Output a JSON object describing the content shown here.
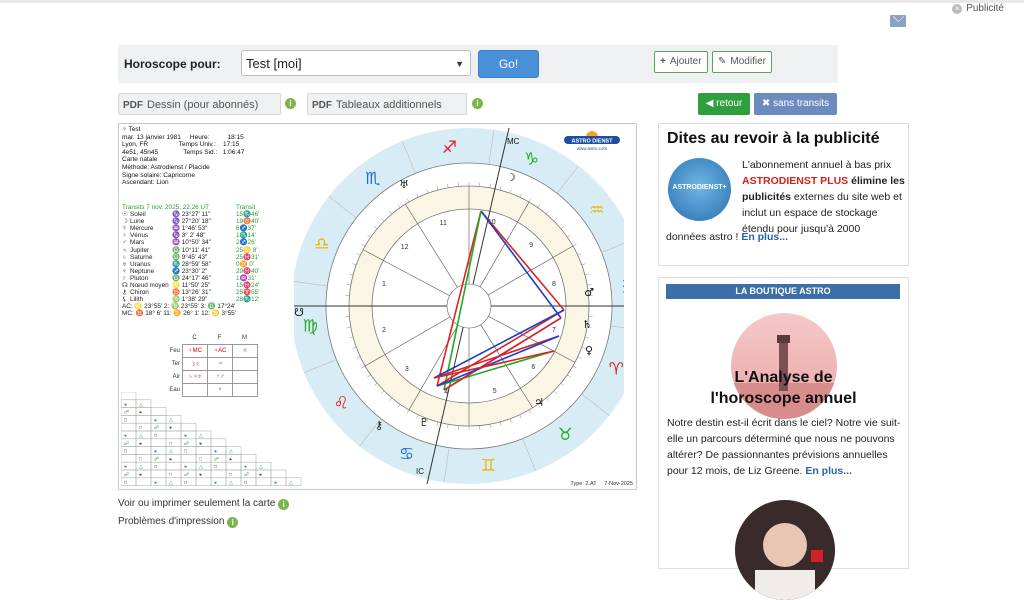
{
  "header": {
    "publicite": "Publicité"
  },
  "form": {
    "label": "Horoscope pour:",
    "selected": "Test [moi]",
    "go": "Go!",
    "ajouter": "Ajouter",
    "modifier": "Modifier"
  },
  "pdf": {
    "tag": "PDF",
    "dessin": "Dessin (pour abonnés)",
    "tableaux": "Tableaux additionnels"
  },
  "nav": {
    "retour": "retour",
    "sans_transits": "sans transits"
  },
  "chart": {
    "info_lines": [
      "♀ Test",
      "mar. 13 janvier 1981     Heure:          18:15",
      "Lyon, FR                 Temps Univ.:    17:15",
      "4e51, 45n45              Temps Sid.:   1:06:47",
      "Carte natale",
      "Méthode: Astrodienst / Placide",
      "Signe solaire: Capricorne",
      "Ascendant: Lion"
    ],
    "transit_header": "Transits 7 nov. 2025, 22:26 UT",
    "transit_label": "Transit",
    "planets": [
      {
        "g": "☉",
        "n": "Soleil",
        "p1": "♑ 23°27' 11\"",
        "p2": "15♏46'"
      },
      {
        "g": "☽",
        "n": "Lune",
        "p1": "♑ 27°20' 18\"",
        "p2": "19♉40'"
      },
      {
        "g": "☿",
        "n": "Mercure",
        "p1": "♒  1°46' 53\"",
        "p2": "6♐37'"
      },
      {
        "g": "♀",
        "n": "Vénus",
        "p1": "♑  3° 2' 48\"",
        "p2": "1♏14'"
      },
      {
        "g": "♂",
        "n": "Mars",
        "p1": "♒ 10°50' 34\"",
        "p2": "2♐26'"
      },
      {
        "g": "♃",
        "n": "Jupiter",
        "p1": "♎ 10°11' 41\"",
        "p2": "25♋ 8'"
      },
      {
        "g": "♄",
        "n": "Saturne",
        "p1": "♎  9°45' 43\"",
        "p2": "25♓31'"
      },
      {
        "g": "♅",
        "n": "Uranus",
        "p1": "♏ 28°59' 58\"",
        "p2": "0♊ 0'"
      },
      {
        "g": "♆",
        "n": "Neptune",
        "p1": "♐ 23°30'  2\"",
        "p2": "29♓40'"
      },
      {
        "g": "♇",
        "n": "Pluton",
        "p1": "♎ 24°17' 46\"",
        "p2": "1♒31'"
      },
      {
        "g": "☊",
        "n": "Nœud moyen",
        "p1": "♌ 11°50' 25\"",
        "p2": "15♓24'"
      },
      {
        "g": "⚷",
        "n": "Chiron",
        "p1": "♉ 13°26' 31\"",
        "p2": "25♈55'"
      },
      {
        "g": "⚸",
        "n": "Lilith",
        "p1": "♍  1°38' 29\"",
        "p2": "28♏12'"
      }
    ],
    "angles": [
      "AC: ♌ 23°55'   2: ♍ 23°55'   3: ♎ 17°24'",
      "MC: ♉ 18° 6'  11: ♊ 26° 1'  12: ♋  3°55'"
    ],
    "elements_head": [
      "C",
      "F",
      "M"
    ],
    "elements_rows": [
      "Feu",
      "Ter",
      "Air",
      "Eau"
    ],
    "elements_vals": [
      [
        "♀MC",
        "♃AC",
        "♅"
      ],
      [
        "☽☿",
        "♃",
        ""
      ],
      [
        "♄♃♅",
        "♇♂",
        ""
      ],
      [
        "",
        "♆",
        ""
      ]
    ],
    "house_numbers": [
      "1",
      "2",
      "3",
      "4",
      "5",
      "6",
      "7",
      "8",
      "9",
      "10",
      "11",
      "12"
    ],
    "angle_labels": [
      "AC",
      "DC",
      "MC",
      "IC"
    ],
    "logo": "ASTRO DIENST",
    "logo_url": "www.astro.com",
    "footer_left": "Type: 2.AT",
    "footer_right": "7-Nov-2025"
  },
  "links": {
    "print": "Voir ou imprimer seulement la carte",
    "problems": "Problèmes d'impression"
  },
  "ad": {
    "title": "Dites au revoir à la publicité",
    "logo_text": "ASTRODIENST+",
    "text_1": "L'abonnement annuel à bas prix ",
    "text_red": "ASTRODIENST PLUS",
    "text_bold": " élimine les publicités",
    "text_2": " externes du site web et inclut un espace de stockage étendu pour jusqu'à 2000",
    "text_3": "données astro ! ",
    "more": "En plus..."
  },
  "shop": {
    "header": "LA BOUTIQUE ASTRO",
    "title": "L'Analyse de l'horoscope annuel",
    "text": "Notre destin est-il écrit dans le ciel? Notre vie suit-elle un parcours déterminé que nous ne pouvons altérer? De passionnantes prévisions annuelles pour 12 mois, de Liz Greene. ",
    "more": "En plus..."
  }
}
